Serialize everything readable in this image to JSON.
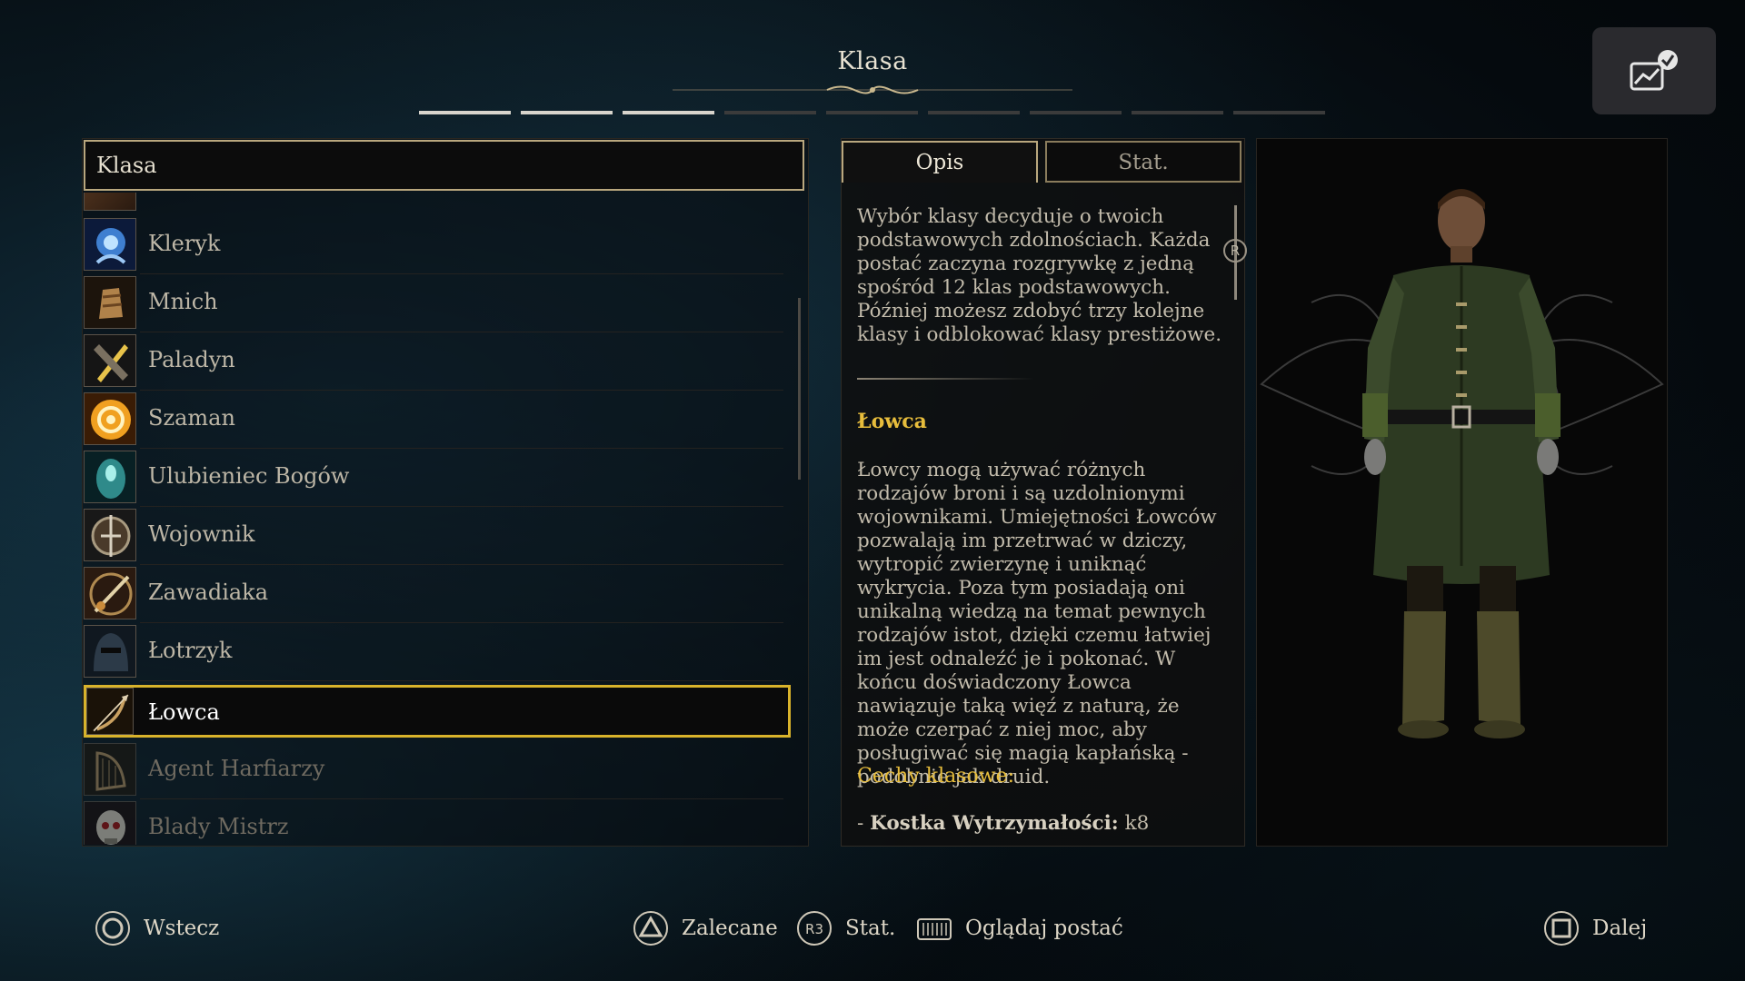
{
  "header": {
    "title": "Klasa",
    "steps_total": 9,
    "steps_completed": 3,
    "corner_button_icon": "chart-check-icon"
  },
  "class_list": {
    "header_label": "Klasa",
    "items": [
      {
        "label": "Kleryk",
        "icon": "cleric-icon",
        "state": "normal"
      },
      {
        "label": "Mnich",
        "icon": "monk-icon",
        "state": "normal"
      },
      {
        "label": "Paladyn",
        "icon": "paladin-icon",
        "state": "normal"
      },
      {
        "label": "Szaman",
        "icon": "shaman-icon",
        "state": "normal"
      },
      {
        "label": "Ulubieniec Bogów",
        "icon": "favored-soul-icon",
        "state": "normal"
      },
      {
        "label": "Wojownik",
        "icon": "fighter-icon",
        "state": "normal"
      },
      {
        "label": "Zawadiaka",
        "icon": "swashbuckler-icon",
        "state": "normal"
      },
      {
        "label": "Łotrzyk",
        "icon": "rogue-icon",
        "state": "normal"
      },
      {
        "label": "Łowca",
        "icon": "ranger-icon",
        "state": "selected"
      },
      {
        "label": "Agent Harfiarzy",
        "icon": "harper-agent-icon",
        "state": "disabled"
      },
      {
        "label": "Blady Mistrz",
        "icon": "pale-master-icon",
        "state": "disabled"
      }
    ]
  },
  "info_panel": {
    "tabs": [
      "Opis",
      "Stat."
    ],
    "active_tab": "Opis",
    "scroll_badge": "R",
    "intro": "Wybór klasy decyduje o twoich podstawowych zdolnościach. Każda postać zaczyna rozgrywkę z jedną spośród 12 klas podstawowych. Później możesz zdobyć trzy kolejne klasy i odblokować klasy prestiżowe.",
    "class_name": "Łowca",
    "class_description": "Łowcy mogą używać różnych rodzajów broni i są uzdolnionymi wojownikami. Umiejętności Łowców pozwalają im przetrwać w dziczy, wytropić zwierzynę i uniknąć wykrycia. Poza tym posiadają oni unikalną wiedzą na temat pewnych rodzajów istot, dzięki czemu łatwiej im jest odnaleźć je i pokonać. W końcu doświadczony Łowca nawiązuje taką więź z naturą, że może czerpać z niej moc, aby posługiwać się magią kapłańską - podobnie jak druid.",
    "traits_title": "Cechy klasowe:",
    "trait_prefix": "- ",
    "trait_label": "Kostka Wytrzymałości:",
    "trait_value": " k8"
  },
  "footer": {
    "back": {
      "label": "Wstecz",
      "icon": "circle-button-icon"
    },
    "recommended": {
      "label": "Zalecane",
      "icon": "triangle-button-icon"
    },
    "stats": {
      "label": "Stat.",
      "icon": "r3-button-icon",
      "glyph": "R3"
    },
    "view_character": {
      "label": "Oglądaj postać",
      "icon": "touchpad-icon"
    },
    "next": {
      "label": "Dalej",
      "icon": "square-button-icon"
    }
  },
  "colors": {
    "accent_gold": "#e7bd3c",
    "selection_border": "#d9b32b",
    "frame_gold": "#b9a77e"
  }
}
